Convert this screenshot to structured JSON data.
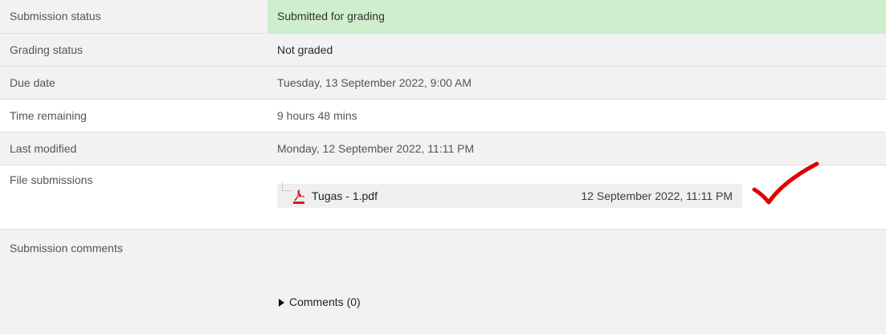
{
  "rows": {
    "submission_status": {
      "label": "Submission status",
      "value": "Submitted for grading"
    },
    "grading_status": {
      "label": "Grading status",
      "value": "Not graded"
    },
    "due_date": {
      "label": "Due date",
      "value": "Tuesday, 13 September 2022, 9:00 AM"
    },
    "time_remaining": {
      "label": "Time remaining",
      "value": "9 hours 48 mins"
    },
    "last_modified": {
      "label": "Last modified",
      "value": "Monday, 12 September 2022, 11:11 PM"
    },
    "file_submissions": {
      "label": "File submissions",
      "file": {
        "name": "Tugas - 1.pdf",
        "date": "12 September 2022, 11:11 PM",
        "icon": "pdf-icon"
      }
    },
    "submission_comments": {
      "label": "Submission comments",
      "toggle": "Comments (0)"
    }
  },
  "colors": {
    "status_submitted_bg": "#cfeecd",
    "row_alt_bg": "#f2f2f2",
    "pdf_red": "#e31b1b",
    "check_red": "#e10000"
  }
}
